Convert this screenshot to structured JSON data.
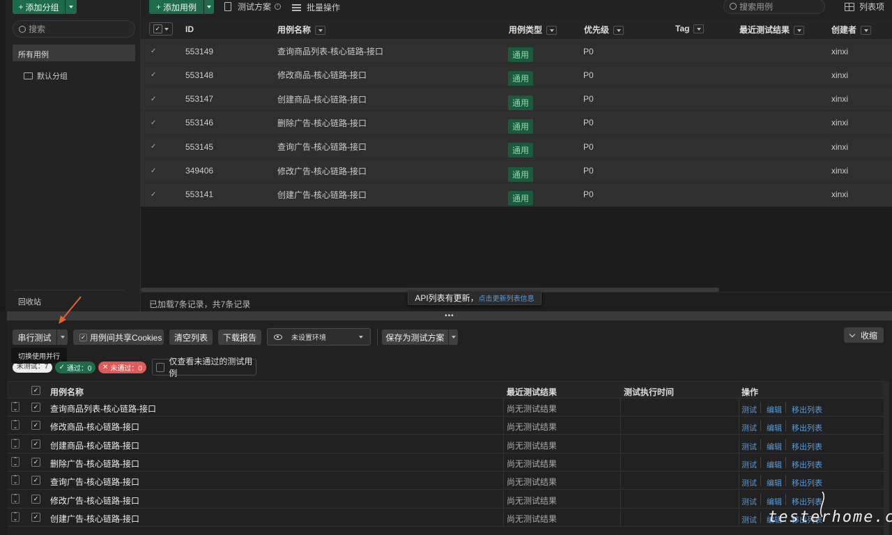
{
  "sidebar": {
    "add_group": "添加分组",
    "search_placeholder": "搜索",
    "all_cases": "所有用例",
    "default_group": "默认分组",
    "recycle": "回收站"
  },
  "toolbar": {
    "add_case": "添加用例",
    "test_plan": "测试方案",
    "batch": "批量操作",
    "search_placeholder": "搜索用例",
    "columns": "列表项"
  },
  "table": {
    "headers": {
      "id": "ID",
      "name": "用例名称",
      "type": "用例类型",
      "priority": "优先级",
      "tag": "Tag",
      "result": "最近测试结果",
      "creator": "创建者"
    },
    "rows": [
      {
        "id": "553149",
        "name": "查询商品列表-核心链路-接口",
        "type": "通用",
        "priority": "P0",
        "creator": "xinxi"
      },
      {
        "id": "553148",
        "name": "修改商品-核心链路-接口",
        "type": "通用",
        "priority": "P0",
        "creator": "xinxi"
      },
      {
        "id": "553147",
        "name": "创建商品-核心链路-接口",
        "type": "通用",
        "priority": "P0",
        "creator": "xinxi"
      },
      {
        "id": "553146",
        "name": "删除广告-核心链路-接口",
        "type": "通用",
        "priority": "P0",
        "creator": "xinxi"
      },
      {
        "id": "553145",
        "name": "查询广告-核心链路-接口",
        "type": "通用",
        "priority": "P0",
        "creator": "xinxi"
      },
      {
        "id": "349406",
        "name": "修改广告-核心链路-接口",
        "type": "通用",
        "priority": "P0",
        "creator": "xinxi"
      },
      {
        "id": "553141",
        "name": "创建广告-核心链路-接口",
        "type": "通用",
        "priority": "P0",
        "creator": "xinxi"
      }
    ],
    "footer": "已加载7条记录，共7条记录"
  },
  "toast": {
    "text": "API列表有更新，",
    "link": "点击更新列表信息"
  },
  "runner": {
    "serial": "串行测试",
    "share_cookies": "用例间共享Cookies",
    "clear": "清空列表",
    "download": "下载报告",
    "env": "未设置环境",
    "save_plan": "保存为测试方案",
    "collapse": "收缩",
    "tooltip": "切换使用并行",
    "untested": "未测试：7",
    "passed": "通过：0",
    "failed": "未通过：0",
    "only_failed": "仅查看未通过的测试用例",
    "headers": {
      "name": "用例名称",
      "result": "最近测试结果",
      "time": "测试执行时间",
      "ops": "操作"
    },
    "ops": {
      "test": "测试",
      "edit": "编辑",
      "remove": "移出列表"
    },
    "rows": [
      {
        "name": "查询商品列表-核心链路-接口",
        "result": "尚无测试结果"
      },
      {
        "name": "修改商品-核心链路-接口",
        "result": "尚无测试结果"
      },
      {
        "name": "创建商品-核心链路-接口",
        "result": "尚无测试结果"
      },
      {
        "name": "删除广告-核心链路-接口",
        "result": "尚无测试结果"
      },
      {
        "name": "查询广告-核心链路-接口",
        "result": "尚无测试结果"
      },
      {
        "name": "修改广告-核心链路-接口",
        "result": "尚无测试结果"
      },
      {
        "name": "创建广告-核心链路-接口",
        "result": "尚无测试结果"
      }
    ]
  },
  "watermark": "testerhome.com",
  "colors": {
    "accent": "#1d6b4a",
    "link": "#5b9bd9",
    "danger": "#e05a5a",
    "arrow": "#e8622c"
  }
}
